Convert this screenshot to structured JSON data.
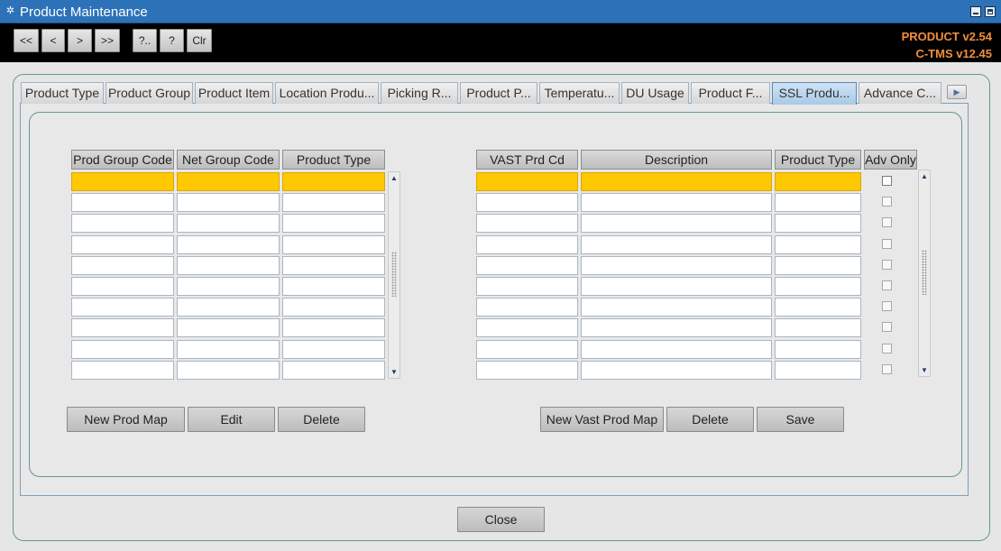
{
  "window": {
    "title": "Product Maintenance",
    "icon": "gear-icon"
  },
  "toolbar": {
    "buttons": [
      "<<",
      "<",
      ">",
      ">>",
      "?..",
      "?",
      "Clr"
    ],
    "version_product": "PRODUCT v2.54",
    "version_ctms": "C-TMS v12.45",
    "version_color": "#f28f3b"
  },
  "tabs": {
    "items": [
      "Product Type",
      "Product Group",
      "Product Item",
      "Location Produ...",
      "Picking R...",
      "Product P...",
      "Temperatu...",
      "DU Usage",
      "Product F...",
      "SSL Produ...",
      "Advance C..."
    ],
    "active": "SSL Produ..."
  },
  "left_table": {
    "columns": [
      "Prod Group Code",
      "Net Group Code",
      "Product Type"
    ],
    "row_count": 10,
    "selected_row": 1,
    "selected_color": "#ffc802"
  },
  "right_table": {
    "columns": [
      "VAST Prd Cd",
      "Description",
      "Product Type",
      "Adv Only"
    ],
    "row_count": 10,
    "selected_row": 1
  },
  "left_buttons": {
    "new": "New Prod Map",
    "edit": "Edit",
    "delete": "Delete"
  },
  "right_buttons": {
    "new": "New Vast Prod Map",
    "delete": "Delete",
    "save": "Save"
  },
  "footer": {
    "close": "Close"
  }
}
